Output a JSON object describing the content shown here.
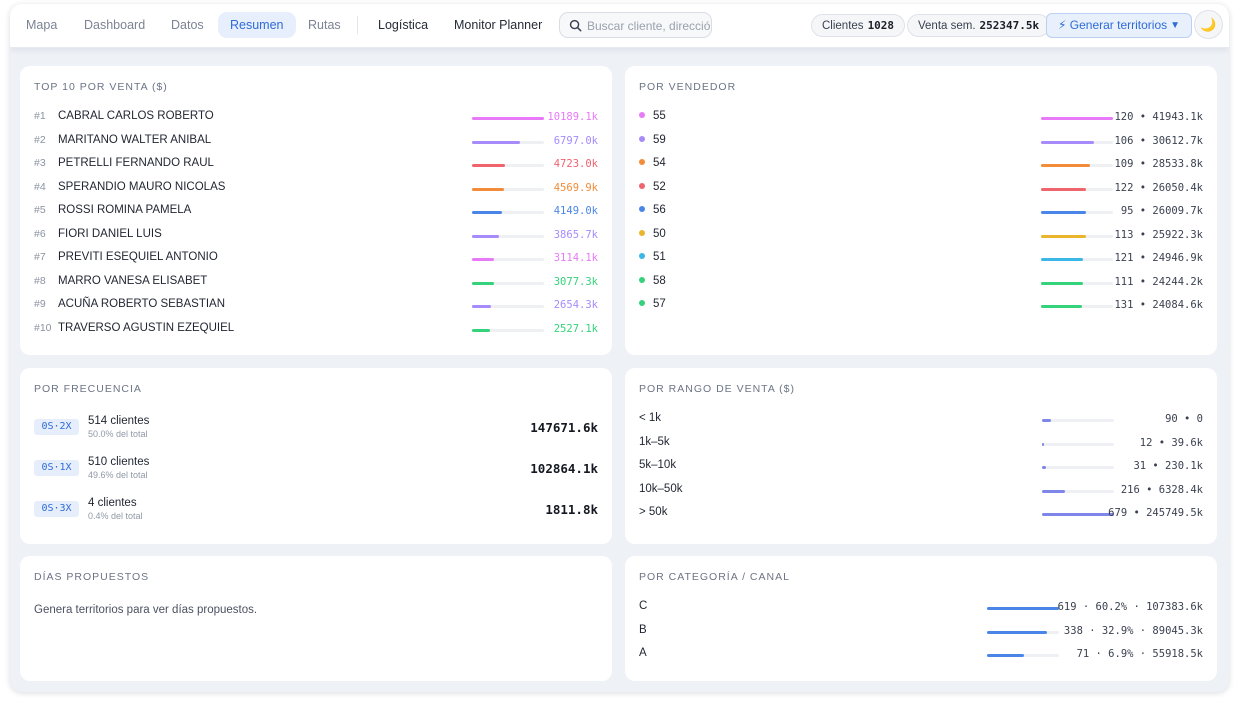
{
  "nav": {
    "tabs": [
      {
        "label": "Mapa"
      },
      {
        "label": "Dashboard"
      },
      {
        "label": "Datos"
      },
      {
        "label": "Resumen"
      },
      {
        "label": "Rutas"
      },
      {
        "label": "Logística"
      },
      {
        "label": "Monitor Planner"
      }
    ],
    "active_tab": "Resumen"
  },
  "search": {
    "placeholder": "Buscar cliente, dirección"
  },
  "stats": {
    "clientes_label": "Clientes",
    "clientes_value": "1028",
    "venta_label": "Venta sem.",
    "venta_value": "252347.5k"
  },
  "generate_button": {
    "label": "⚡ Generar territorios",
    "caret": "▼",
    "icon": "bolt-icon"
  },
  "theme_toggle": {
    "icon": "moon-icon",
    "glyph": "🌙"
  },
  "colors": {
    "accent": "#2f6bd6",
    "pink": "#e879f9",
    "purple": "#a78bfa",
    "red": "#f0646e",
    "orange": "#f28c38",
    "blue": "#4a86e8",
    "yellow": "#eab52a",
    "cyan": "#3bb8e8",
    "green": "#34d27a",
    "indigo": "#7f86ea"
  },
  "top10": {
    "title": "TOP 10 POR VENTA ($)",
    "rows": [
      {
        "rank": "#1",
        "name": "CABRAL CARLOS ROBERTO",
        "value": "10189.1k",
        "share": 1.0,
        "color": "#e879f9"
      },
      {
        "rank": "#2",
        "name": "MARITANO WALTER ANIBAL",
        "value": "6797.0k",
        "share": 0.67,
        "color": "#a78bfa"
      },
      {
        "rank": "#3",
        "name": "PETRELLI FERNANDO RAUL",
        "value": "4723.0k",
        "share": 0.46,
        "color": "#f0646e"
      },
      {
        "rank": "#4",
        "name": "SPERANDIO MAURO NICOLAS",
        "value": "4569.9k",
        "share": 0.45,
        "color": "#f28c38"
      },
      {
        "rank": "#5",
        "name": "ROSSI ROMINA PAMELA",
        "value": "4149.0k",
        "share": 0.41,
        "color": "#4a86e8"
      },
      {
        "rank": "#6",
        "name": "FIORI DANIEL LUIS",
        "value": "3865.7k",
        "share": 0.38,
        "color": "#a78bfa"
      },
      {
        "rank": "#7",
        "name": "PREVITI ESEQUIEL ANTONIO",
        "value": "3114.1k",
        "share": 0.31,
        "color": "#e879f9"
      },
      {
        "rank": "#8",
        "name": "MARRO VANESA ELISABET",
        "value": "3077.3k",
        "share": 0.3,
        "color": "#34d27a"
      },
      {
        "rank": "#9",
        "name": "ACUÑA ROBERTO SEBASTIAN",
        "value": "2654.3k",
        "share": 0.26,
        "color": "#a78bfa"
      },
      {
        "rank": "#10",
        "name": "TRAVERSO AGUSTIN EZEQUIEL",
        "value": "2527.1k",
        "share": 0.25,
        "color": "#34d27a"
      }
    ]
  },
  "vendedor": {
    "title": "POR VENDEDOR",
    "rows": [
      {
        "name": "55",
        "value": "120 • 41943.1k",
        "share": 1.0,
        "color": "#e879f9"
      },
      {
        "name": "59",
        "value": "106 • 30612.7k",
        "share": 0.73,
        "color": "#a78bfa"
      },
      {
        "name": "54",
        "value": "109 • 28533.8k",
        "share": 0.68,
        "color": "#f28c38"
      },
      {
        "name": "52",
        "value": "122 • 26050.4k",
        "share": 0.62,
        "color": "#f0646e"
      },
      {
        "name": "56",
        "value": "95 • 26009.7k",
        "share": 0.62,
        "color": "#4a86e8"
      },
      {
        "name": "50",
        "value": "113 • 25922.3k",
        "share": 0.62,
        "color": "#eab52a"
      },
      {
        "name": "51",
        "value": "121 • 24946.9k",
        "share": 0.59,
        "color": "#3bb8e8"
      },
      {
        "name": "58",
        "value": "111 • 24244.2k",
        "share": 0.58,
        "color": "#34d27a"
      },
      {
        "name": "57",
        "value": "131 • 24084.6k",
        "share": 0.57,
        "color": "#34d27a"
      }
    ]
  },
  "frecuencia": {
    "title": "POR FRECUENCIA",
    "rows": [
      {
        "tag": "0S·2X",
        "count": "514 clientes",
        "pct": "50.0% del total",
        "value": "147671.6k"
      },
      {
        "tag": "0S·1X",
        "count": "510 clientes",
        "pct": "49.6% del total",
        "value": "102864.1k"
      },
      {
        "tag": "0S·3X",
        "count": "4 clientes",
        "pct": "0.4% del total",
        "value": "1811.8k"
      }
    ]
  },
  "rango": {
    "title": "POR RANGO DE VENTA ($)",
    "rows": [
      {
        "name": "< 1k",
        "value": "90 • 0",
        "share": 0.13,
        "color": "#7f86ea"
      },
      {
        "name": "1k–5k",
        "value": "12 • 39.6k",
        "share": 0.02,
        "color": "#7f86ea"
      },
      {
        "name": "5k–10k",
        "value": "31 • 230.1k",
        "share": 0.05,
        "color": "#7f86ea"
      },
      {
        "name": "10k–50k",
        "value": "216 • 6328.4k",
        "share": 0.32,
        "color": "#7f86ea"
      },
      {
        "name": "> 50k",
        "value": "679 • 245749.5k",
        "share": 1.0,
        "color": "#7f86ea"
      }
    ]
  },
  "dias": {
    "title": "DÍAS PROPUESTOS",
    "message": "Genera territorios para ver días propuestos."
  },
  "categoria": {
    "title": "POR CATEGORÍA / CANAL",
    "rows": [
      {
        "name": "C",
        "value": "619 · 60.2% · 107383.6k",
        "share": 1.0,
        "color": "#4a86e8"
      },
      {
        "name": "B",
        "value": "338 · 32.9% · 89045.3k",
        "share": 0.83,
        "color": "#4a86e8"
      },
      {
        "name": "A",
        "value": "71 · 6.9% · 55918.5k",
        "share": 0.52,
        "color": "#4a86e8"
      }
    ]
  }
}
